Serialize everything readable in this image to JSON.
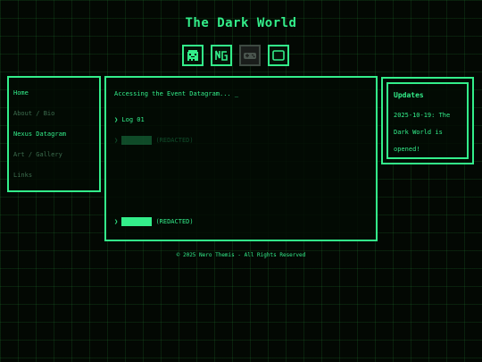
{
  "header": {
    "title": "The Dark World"
  },
  "icons": [
    {
      "name": "ghost-icon",
      "active": true
    },
    {
      "name": "ng-icon",
      "active": true
    },
    {
      "name": "controller-icon",
      "active": false
    },
    {
      "name": "monitor-icon",
      "active": true
    }
  ],
  "nav": {
    "items": [
      {
        "label": "Home",
        "active": true
      },
      {
        "label": "About / Bio",
        "active": false
      },
      {
        "label": "Nexus Datagram",
        "active": true
      },
      {
        "label": "Art / Gallery",
        "active": false
      },
      {
        "label": "Links",
        "active": false
      }
    ]
  },
  "main": {
    "intro": "Accessing the Event Datagram... _",
    "log1": "❯ Log 01",
    "faded_prompt": "❯",
    "faded_redacted": "(REDACTED)",
    "bottom_prompt": "❯",
    "bottom_redacted": "(REDACTED)"
  },
  "updates": {
    "title": "Updates",
    "text": "2025-10-19: The Dark World is opened!"
  },
  "footer": {
    "text": "© 2025 Nero Themis - All Rights Reserved"
  },
  "colors": {
    "accent": "#33ee8a",
    "background": "#030803",
    "muted": "#3d6e4f"
  }
}
